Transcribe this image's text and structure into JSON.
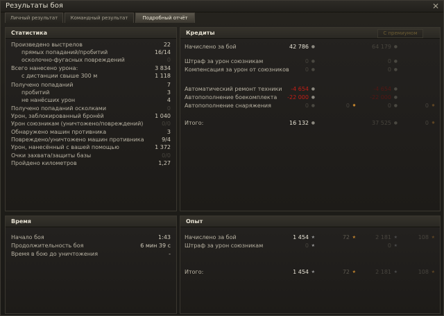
{
  "window": {
    "title": "Результаты боя"
  },
  "tabs": [
    "Личный результат",
    "Командный результат",
    "Подробный отчёт"
  ],
  "stats": {
    "title": "Статистика",
    "rows": [
      {
        "label": "Произведено выстрелов",
        "value": "22"
      },
      {
        "label": "прямых попаданий/пробитий",
        "value": "16/14"
      },
      {
        "label": "осколочно-фугасных повреждений",
        "value": "0"
      },
      {
        "label": "Всего нанесено урона:",
        "value": "3 834"
      },
      {
        "label": "с дистанции свыше 300 м",
        "value": "1 118"
      },
      {
        "label": "Получено попаданий",
        "value": "7"
      },
      {
        "label": "пробитий",
        "value": "3"
      },
      {
        "label": "не нанёсших урон",
        "value": "4"
      },
      {
        "label": "Получено попаданий осколками",
        "value": "0"
      },
      {
        "label": "Урон, заблокированный бронёй",
        "value": "1 040"
      },
      {
        "label": "Урон союзникам (уничтожено/повреждений)",
        "value": "0/0"
      },
      {
        "label": "Обнаружено машин противника",
        "value": "3"
      },
      {
        "label": "Повреждено/уничтожено машин противника",
        "value": "9/4"
      },
      {
        "label": "Урон, нанесённый с вашей помощью",
        "value": "1 372"
      },
      {
        "label": "Очки захвата/защиты базы",
        "value": "0/0"
      },
      {
        "label": "Пройдено километров",
        "value": "1,27"
      }
    ]
  },
  "credits": {
    "title": "Кредиты",
    "premium_label": "С премиумом",
    "rows": [
      {
        "label": "Начислено за бой",
        "c1": "42 786",
        "c2": "",
        "c3": "64 179",
        "c4": ""
      },
      {
        "label": "Штраф за урон союзникам",
        "c1": "0",
        "c2": "",
        "c3": "0",
        "c4": ""
      },
      {
        "label": "Компенсация за урон от союзников",
        "c1": "0",
        "c2": "",
        "c3": "0",
        "c4": ""
      },
      {
        "label": "Автоматический ремонт техники",
        "c1": "-4 654",
        "c2": "",
        "c3": "-4 654",
        "c4": ""
      },
      {
        "label": "Автопополнение боекомплекта",
        "c1": "-22 000",
        "c2": "",
        "c3": "-22 000",
        "c4": ""
      },
      {
        "label": "Автопополнение снаряжения",
        "c1": "0",
        "c2": "0",
        "c3": "0",
        "c4": "0"
      },
      {
        "label": "Итого:",
        "c1": "16 132",
        "c2": "",
        "c3": "37 525",
        "c4": "0"
      }
    ]
  },
  "time": {
    "title": "Время",
    "rows": [
      {
        "label": "Начало боя",
        "value": "1:43"
      },
      {
        "label": "Продолжительность боя",
        "value": "6 мин 39 с"
      },
      {
        "label": "Время в бою до уничтожения",
        "value": "-"
      }
    ]
  },
  "experience": {
    "title": "Опыт",
    "rows": [
      {
        "label": "Начислено за бой",
        "c1": "1 454",
        "c2": "72",
        "c3": "2 181",
        "c4": "108"
      },
      {
        "label": "Штраф за урон союзникам",
        "c1": "0",
        "c2": "",
        "c3": "0",
        "c4": ""
      },
      {
        "label": "Итого:",
        "c1": "1 454",
        "c2": "72",
        "c3": "2 181",
        "c4": "108"
      }
    ]
  },
  "icons": {
    "credits": "silver-coin-icon",
    "xp": "xp-star-icon",
    "free_xp": "free-xp-star-icon",
    "close": "close-icon"
  },
  "colors": {
    "negative": "#c41e17",
    "accent_gold": "#c5852d"
  }
}
